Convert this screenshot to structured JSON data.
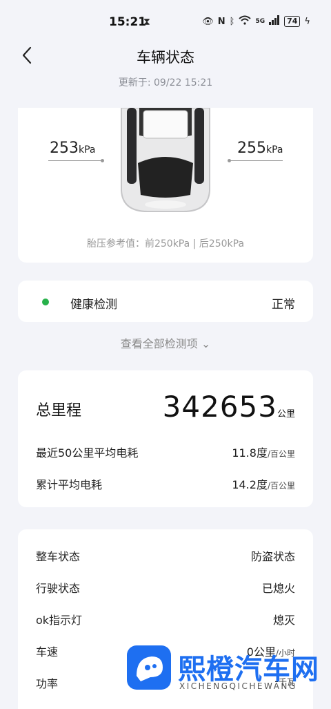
{
  "status_bar": {
    "time": "15:21",
    "battery": "74",
    "network": "5G",
    "icons": [
      "hourglass-icon",
      "eye-icon",
      "nfc-icon",
      "bluetooth-icon",
      "wifi-icon",
      "signal-icon",
      "battery-icon",
      "charging-icon"
    ]
  },
  "header": {
    "title": "车辆状态",
    "updated": "更新于: 09/22 15:21"
  },
  "tires": {
    "front_left": "253",
    "front_right": "255",
    "unit": "kPa",
    "reference": "胎压参考值：前250kPa | 后250kPa"
  },
  "health": {
    "label": "健康检测",
    "status": "正常",
    "status_color": "#27b14a"
  },
  "view_all": "查看全部检测项 ⌄",
  "mileage": {
    "label": "总里程",
    "value": "342653",
    "unit": "公里",
    "rows": [
      {
        "label": "最近50公里平均电耗",
        "value": "11.8度",
        "unit": "/百公里"
      },
      {
        "label": "累计平均电耗",
        "value": "14.2度",
        "unit": "/百公里"
      }
    ]
  },
  "vehicle_status": [
    {
      "label": "整车状态",
      "value": "防盗状态",
      "unit": ""
    },
    {
      "label": "行驶状态",
      "value": "已熄火",
      "unit": ""
    },
    {
      "label": "ok指示灯",
      "value": "熄灭",
      "unit": ""
    },
    {
      "label": "车速",
      "value": "0公里",
      "unit": "/小时"
    },
    {
      "label": "功率",
      "value": "-",
      "unit": "千瓦"
    }
  ],
  "watermark": {
    "title": "熙橙汽车网",
    "subtitle": "XICHENGQICHEWANG",
    "color": "#1e6ff1"
  }
}
